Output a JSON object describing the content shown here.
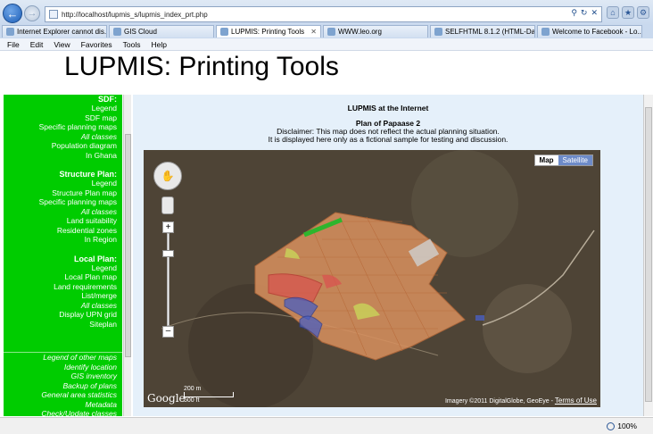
{
  "browser": {
    "url": "http://localhost/lupmis_s/lupmis_index_prt.php",
    "tabs": [
      {
        "label": "Internet Explorer cannot dis..."
      },
      {
        "label": "GIS Cloud"
      },
      {
        "label": "LUPMIS: Printing Tools",
        "active": true
      },
      {
        "label": "WWW.leo.org"
      },
      {
        "label": "SELFHTML 8.1.2 (HTML-Dat..."
      },
      {
        "label": "Welcome to Facebook - Lo..."
      }
    ],
    "menu": [
      "File",
      "Edit",
      "View",
      "Favorites",
      "Tools",
      "Help"
    ],
    "zoom": "100%"
  },
  "page": {
    "title": "LUPMIS: Printing Tools"
  },
  "sidebar": {
    "sdf": {
      "title": "SDF:",
      "items": [
        "Legend",
        "SDF map",
        "Specific planning maps",
        "All classes",
        "Population diagram",
        "In Ghana"
      ]
    },
    "structure": {
      "title": "Structure Plan:",
      "items": [
        "Legend",
        "Structure Plan map",
        "Specific planning maps",
        "All classes",
        "Land suitability",
        "Residential zones",
        "In Region"
      ]
    },
    "local": {
      "title": "Local Plan:",
      "items": [
        "Legend",
        "Local Plan map",
        "Land requirements",
        "List/merge",
        "All classes",
        "Display UPN grid",
        "Siteplan"
      ]
    },
    "other": [
      "Legend of other maps",
      "Identify location",
      "GIS inventory",
      "Backup of plans",
      "General area statistics",
      "Metadata",
      "Check/Update classes"
    ]
  },
  "main": {
    "heading": "LUPMIS at the Internet",
    "plan_title": "Plan of Papaase 2",
    "disclaimer_1": "Disclaimer: This map does not reflect the actual planning situation.",
    "disclaimer_2": "It is displayed here only as a fictional sample for testing and discussion."
  },
  "map": {
    "type_map": "Map",
    "type_satellite": "Satellite",
    "logo": "Google",
    "scale_m": "200 m",
    "scale_ft": "500 ft",
    "attribution": "Imagery ©2011 DigitalGlobe, GeoEye - ",
    "terms": "Terms of Use",
    "pan_icon": "hand-icon",
    "colors": {
      "plots": "#d9915f",
      "green_strip": "#2db52d",
      "red_zone": "#d9534f",
      "blue_zone": "#4a5fc1",
      "yellow_zone": "#c9d45a"
    }
  }
}
